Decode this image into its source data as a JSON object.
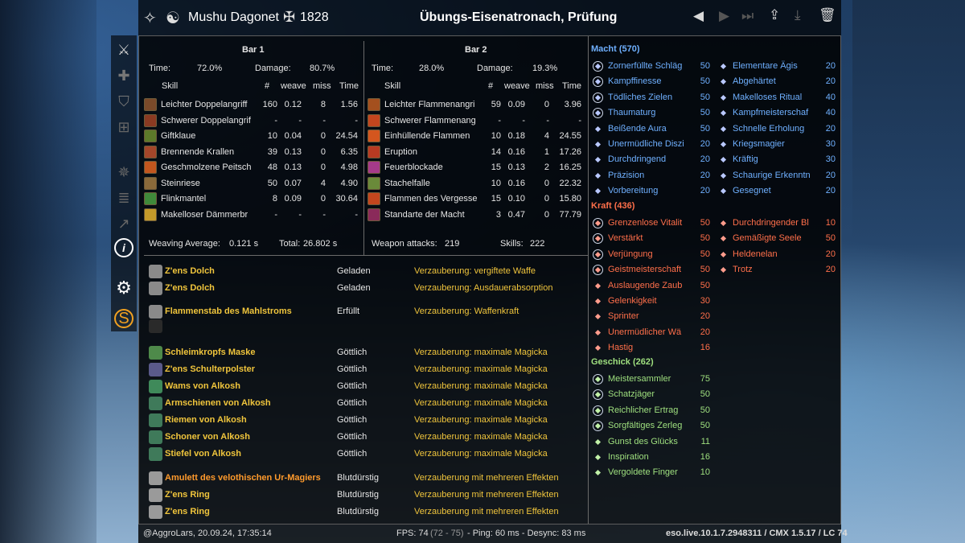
{
  "header": {
    "player_name": "Mushu Dagonet",
    "champion_points": "1828",
    "fight_title": "Übungs-Eisenatronach, Prüfung"
  },
  "bar1": {
    "title": "Bar 1",
    "time_label": "Time:",
    "time_value": "72.0%",
    "damage_label": "Damage:",
    "damage_value": "80.7%",
    "columns": [
      "Skill",
      "#",
      "weave",
      "miss",
      "Time"
    ],
    "skills": [
      {
        "name": "Leichter Doppelangriff",
        "count": "160",
        "weave": "0.12",
        "miss": "8",
        "time": "1.56",
        "color": "#7a4a2a"
      },
      {
        "name": "Schwerer Doppelangrif",
        "count": "-",
        "weave": "-",
        "miss": "-",
        "time": "-",
        "color": "#8a3a22"
      },
      {
        "name": "Giftklaue",
        "count": "10",
        "weave": "0.04",
        "miss": "0",
        "time": "24.54",
        "color": "#5d7a2a"
      },
      {
        "name": "Brennende Krallen",
        "count": "39",
        "weave": "0.13",
        "miss": "0",
        "time": "6.35",
        "color": "#a4462a"
      },
      {
        "name": "Geschmolzene Peitsch",
        "count": "48",
        "weave": "0.13",
        "miss": "0",
        "time": "4.98",
        "color": "#c2561e"
      },
      {
        "name": "Steinriese",
        "count": "50",
        "weave": "0.07",
        "miss": "4",
        "time": "4.90",
        "color": "#8a6a3a"
      },
      {
        "name": "Flinkmantel",
        "count": "8",
        "weave": "0.09",
        "miss": "0",
        "time": "30.64",
        "color": "#3f8a3a"
      },
      {
        "name": "Makelloser Dämmerbr",
        "count": "-",
        "weave": "-",
        "miss": "-",
        "time": "-",
        "color": "#c49a2a"
      }
    ],
    "weaving_label": "Weaving Average:",
    "weaving_value": "0.121 s",
    "total_label": "Total:",
    "total_value": "26.802 s"
  },
  "bar2": {
    "title": "Bar 2",
    "time_label": "Time:",
    "time_value": "28.0%",
    "damage_label": "Damage:",
    "damage_value": "19.3%",
    "columns": [
      "Skill",
      "#",
      "weave",
      "miss",
      "Time"
    ],
    "skills": [
      {
        "name": "Leichter Flammenangri",
        "count": "59",
        "weave": "0.09",
        "miss": "0",
        "time": "3.96",
        "color": "#a4501e"
      },
      {
        "name": "Schwerer Flammenang",
        "count": "-",
        "weave": "-",
        "miss": "-",
        "time": "-",
        "color": "#c2461e"
      },
      {
        "name": "Einhüllende Flammen",
        "count": "10",
        "weave": "0.18",
        "miss": "4",
        "time": "24.55",
        "color": "#d4561e"
      },
      {
        "name": "Eruption",
        "count": "14",
        "weave": "0.16",
        "miss": "1",
        "time": "17.26",
        "color": "#b83a22"
      },
      {
        "name": "Feuerblockade",
        "count": "15",
        "weave": "0.13",
        "miss": "2",
        "time": "16.25",
        "color": "#a63a8a"
      },
      {
        "name": "Stachelfalle",
        "count": "10",
        "weave": "0.16",
        "miss": "0",
        "time": "22.32",
        "color": "#6a8a3a"
      },
      {
        "name": "Flammen des Vergesse",
        "count": "15",
        "weave": "0.10",
        "miss": "0",
        "time": "15.80",
        "color": "#c2461e"
      },
      {
        "name": "Standarte der Macht",
        "count": "3",
        "weave": "0.47",
        "miss": "0",
        "time": "77.79",
        "color": "#8a2a5a"
      }
    ],
    "attacks_label": "Weapon attacks:",
    "attacks_value": "219",
    "skills_label": "Skills:",
    "skills_value": "222"
  },
  "gear": [
    {
      "name": "Z'ens Dolch",
      "trait": "Geladen",
      "enchant": "Verzauberung: vergiftete Waffe",
      "quality_color": "#f0c53c",
      "icon": "dagger-icon"
    },
    {
      "name": "Z'ens Dolch",
      "trait": "Geladen",
      "enchant": "Verzauberung: Ausdauerabsorption",
      "quality_color": "#f0c53c",
      "icon": "dagger-icon"
    },
    {
      "name": "Flammenstab des Mahlstroms",
      "trait": "Erfüllt",
      "enchant": "Verzauberung: Waffenkraft",
      "quality_color": "#f0c53c",
      "icon": "staff-icon"
    },
    {
      "name": "Schleimkropfs Maske",
      "trait": "Göttlich",
      "enchant": "Verzauberung: maximale Magicka",
      "quality_color": "#f0c53c",
      "icon": "mask-icon"
    },
    {
      "name": "Z'ens Schulterpolster",
      "trait": "Göttlich",
      "enchant": "Verzauberung: maximale Magicka",
      "quality_color": "#f0c53c",
      "icon": "shoulder-icon"
    },
    {
      "name": "Wams von Alkosh",
      "trait": "Göttlich",
      "enchant": "Verzauberung: maximale Magicka",
      "quality_color": "#f0c53c",
      "icon": "chest-icon"
    },
    {
      "name": "Armschienen von Alkosh",
      "trait": "Göttlich",
      "enchant": "Verzauberung: maximale Magicka",
      "quality_color": "#f0c53c",
      "icon": "arms-icon"
    },
    {
      "name": "Riemen von Alkosh",
      "trait": "Göttlich",
      "enchant": "Verzauberung: maximale Magicka",
      "quality_color": "#f0c53c",
      "icon": "belt-icon"
    },
    {
      "name": "Schoner von Alkosh",
      "trait": "Göttlich",
      "enchant": "Verzauberung: maximale Magicka",
      "quality_color": "#f0c53c",
      "icon": "legs-icon"
    },
    {
      "name": "Stiefel von Alkosh",
      "trait": "Göttlich",
      "enchant": "Verzauberung: maximale Magicka",
      "quality_color": "#f0c53c",
      "icon": "boots-icon"
    },
    {
      "name": "Amulett des velothischen Ur-Magiers",
      "trait": "Blutdürstig",
      "enchant": "Verzauberung mit mehreren Effekten",
      "quality_color": "#ff9a2c",
      "icon": "amulet-icon"
    },
    {
      "name": "Z'ens Ring",
      "trait": "Blutdürstig",
      "enchant": "Verzauberung mit mehreren Effekten",
      "quality_color": "#f0c53c",
      "icon": "ring-icon"
    },
    {
      "name": "Z'ens Ring",
      "trait": "Blutdürstig",
      "enchant": "Verzauberung mit mehreren Effekten",
      "quality_color": "#f0c53c",
      "icon": "ring-icon"
    }
  ],
  "cp": {
    "macht": {
      "title": "Macht (570)",
      "left": [
        {
          "name": "Zornerfüllte Schläg",
          "value": "50",
          "slotted": true
        },
        {
          "name": "Kampffinesse",
          "value": "50",
          "slotted": true
        },
        {
          "name": "Tödliches Zielen",
          "value": "50",
          "slotted": true
        },
        {
          "name": "Thaumaturg",
          "value": "50",
          "slotted": true
        },
        {
          "name": "Beißende Aura",
          "value": "50",
          "slotted": false
        },
        {
          "name": "Unermüdliche Diszi",
          "value": "20",
          "slotted": false
        },
        {
          "name": "Durchdringend",
          "value": "20",
          "slotted": false
        },
        {
          "name": "Präzision",
          "value": "20",
          "slotted": false
        },
        {
          "name": "Vorbereitung",
          "value": "20",
          "slotted": false
        }
      ],
      "right": [
        {
          "name": "Elementare Ägis",
          "value": "20"
        },
        {
          "name": "Abgehärtet",
          "value": "20"
        },
        {
          "name": "Makelloses Ritual",
          "value": "40"
        },
        {
          "name": "Kampfmeisterschaf",
          "value": "40"
        },
        {
          "name": "Schnelle Erholung",
          "value": "20"
        },
        {
          "name": "Kriegsmagier",
          "value": "30"
        },
        {
          "name": "Kräftig",
          "value": "30"
        },
        {
          "name": "Schaurige Erkenntn",
          "value": "20"
        },
        {
          "name": "Gesegnet",
          "value": "20"
        }
      ]
    },
    "kraft": {
      "title": "Kraft (436)",
      "left": [
        {
          "name": "Grenzenlose Vitalit",
          "value": "50",
          "slotted": true
        },
        {
          "name": "Verstärkt",
          "value": "50",
          "slotted": true
        },
        {
          "name": "Verjüngung",
          "value": "50",
          "slotted": true
        },
        {
          "name": "Geistmeisterschaft",
          "value": "50",
          "slotted": true
        },
        {
          "name": "Auslaugende Zaub",
          "value": "50",
          "slotted": false
        },
        {
          "name": "Gelenkigkeit",
          "value": "30",
          "slotted": false
        },
        {
          "name": "Sprinter",
          "value": "20",
          "slotted": false
        },
        {
          "name": "Unermüdlicher Wä",
          "value": "20",
          "slotted": false
        },
        {
          "name": "Hastig",
          "value": "16",
          "slotted": false
        }
      ],
      "right": [
        {
          "name": "Durchdringender Bl",
          "value": "10"
        },
        {
          "name": "Gemäßigte Seele",
          "value": "50"
        },
        {
          "name": "Heldenelan",
          "value": "20"
        },
        {
          "name": "Trotz",
          "value": "20"
        }
      ]
    },
    "geschick": {
      "title": "Geschick (262)",
      "left": [
        {
          "name": "Meistersammler",
          "value": "75",
          "slotted": true
        },
        {
          "name": "Schatzjäger",
          "value": "50",
          "slotted": true
        },
        {
          "name": "Reichlicher Ertrag",
          "value": "50",
          "slotted": true
        },
        {
          "name": "Sorgfältiges Zerleg",
          "value": "50",
          "slotted": true
        },
        {
          "name": "Gunst des Glücks",
          "value": "11",
          "slotted": false
        },
        {
          "name": "Inspiration",
          "value": "16",
          "slotted": false
        },
        {
          "name": "Vergoldete Finger",
          "value": "10",
          "slotted": false
        }
      ]
    }
  },
  "footer": {
    "author": "@AggroLars, 20.09.24, 17:35:14",
    "fps_label": "FPS: 74",
    "fps_range": "(72 - 75)",
    "ping": "- Ping: 60 ms - Desync: 83 ms",
    "version": "eso.live.10.1.7.2948311 / CMX 1.5.17 / LC 74"
  },
  "colors": {
    "gold": "#f0c53c",
    "orange": "#ff9a2c",
    "macht": "#6fb0ff",
    "kraft": "#ff6f4a",
    "geschick": "#9fe07f"
  }
}
